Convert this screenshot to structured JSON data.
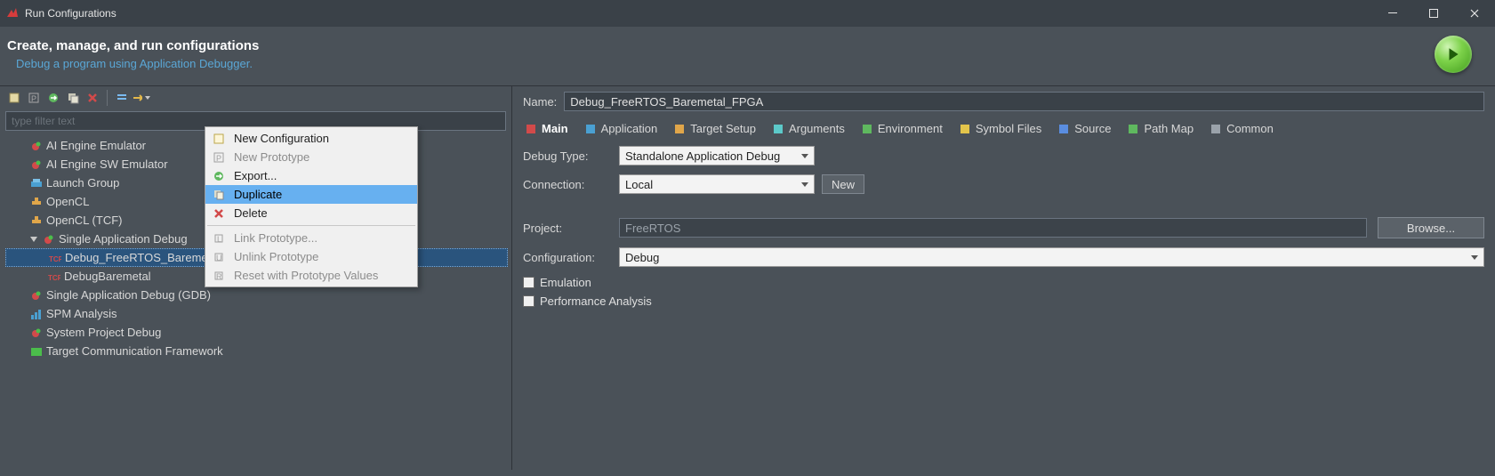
{
  "window": {
    "title": "Run Configurations",
    "min_tooltip": "Minimize",
    "max_tooltip": "Maximize",
    "close_tooltip": "Close"
  },
  "banner": {
    "heading": "Create, manage, and run configurations",
    "subtitle": "Debug a program using Application Debugger."
  },
  "filter": {
    "placeholder": "type filter text"
  },
  "tree": {
    "items": [
      {
        "label": "AI Engine Emulator",
        "icon": "bug",
        "depth": 1
      },
      {
        "label": "AI Engine SW Emulator",
        "icon": "bug",
        "depth": 1
      },
      {
        "label": "Launch Group",
        "icon": "group",
        "depth": 1
      },
      {
        "label": "OpenCL",
        "icon": "circuit",
        "depth": 1
      },
      {
        "label": "OpenCL (TCF)",
        "icon": "circuit",
        "depth": 1
      },
      {
        "label": "Single Application Debug",
        "icon": "bug",
        "depth": 1,
        "expanded": true
      },
      {
        "label": "Debug_FreeRTOS_Baremetal_FPGA",
        "icon": "tcf",
        "depth": 2,
        "selected": true
      },
      {
        "label": "DebugBaremetal",
        "icon": "tcf",
        "depth": 2
      },
      {
        "label": "Single Application Debug (GDB)",
        "icon": "bug",
        "depth": 1
      },
      {
        "label": "SPM Analysis",
        "icon": "chart",
        "depth": 1
      },
      {
        "label": "System Project Debug",
        "icon": "bug",
        "depth": 1
      },
      {
        "label": "Target Communication Framework",
        "icon": "tcf-green",
        "depth": 1
      }
    ]
  },
  "context_menu": {
    "items": [
      {
        "label": "New Configuration",
        "icon": "new",
        "enabled": true
      },
      {
        "label": "New Prototype",
        "icon": "proto",
        "enabled": false
      },
      {
        "label": "Export...",
        "icon": "export",
        "enabled": true
      },
      {
        "label": "Duplicate",
        "icon": "copy",
        "enabled": true,
        "highlight": true
      },
      {
        "label": "Delete",
        "icon": "delete",
        "enabled": true
      },
      {
        "sep": true
      },
      {
        "label": "Link Prototype...",
        "icon": "link",
        "enabled": false
      },
      {
        "label": "Unlink Prototype",
        "icon": "unlink",
        "enabled": false
      },
      {
        "label": "Reset with Prototype Values",
        "icon": "reset",
        "enabled": false
      }
    ]
  },
  "right": {
    "name_label": "Name:",
    "name_value": "Debug_FreeRTOS_Baremetal_FPGA",
    "tabs": [
      {
        "label": "Main",
        "active": true,
        "icon": "red"
      },
      {
        "label": "Application",
        "icon": "blue"
      },
      {
        "label": "Target Setup",
        "icon": "orange"
      },
      {
        "label": "Arguments",
        "icon": "cyan"
      },
      {
        "label": "Environment",
        "icon": "green-env"
      },
      {
        "label": "Symbol Files",
        "icon": "yellow"
      },
      {
        "label": "Source",
        "icon": "blue2"
      },
      {
        "label": "Path Map",
        "icon": "green"
      },
      {
        "label": "Common",
        "icon": "gray"
      }
    ],
    "debug_type_label": "Debug Type:",
    "debug_type_value": "Standalone Application Debug",
    "connection_label": "Connection:",
    "connection_value": "Local",
    "new_button": "New",
    "project_label": "Project:",
    "project_value": "FreeRTOS",
    "browse_button": "Browse...",
    "configuration_label": "Configuration:",
    "configuration_value": "Debug",
    "emulation_label": "Emulation",
    "perf_label": "Performance Analysis"
  }
}
